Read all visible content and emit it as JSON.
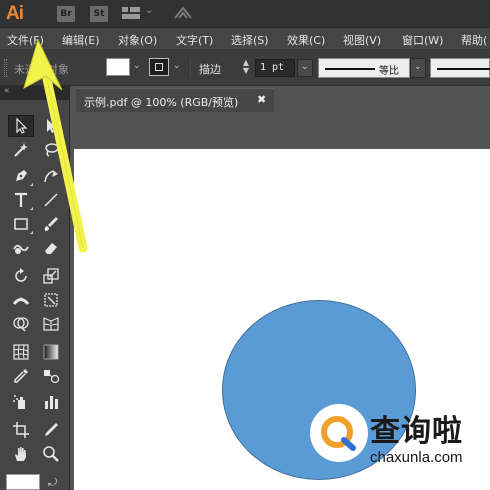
{
  "app": {
    "logo": "Ai",
    "bridge_badge": "Br",
    "stock_badge": "St",
    "accent_color": "#e8883a"
  },
  "menu": {
    "items": [
      "文件(F)",
      "编辑(E)",
      "对象(O)",
      "文字(T)",
      "选择(S)",
      "效果(C)",
      "视图(V)",
      "窗口(W)",
      "帮助("
    ]
  },
  "control": {
    "no_selection": "未选择对象",
    "stroke_label": "描边",
    "stroke_value": "1 pt",
    "profile_label": "等比"
  },
  "document": {
    "tab_label": "示例.pdf @ 100% (RGB/预览)",
    "close_symbol": "✖",
    "circle_fill": "#5b9bd5"
  },
  "watermark": {
    "brand": "查询啦",
    "url": "chaxunla.com"
  },
  "tools": [
    "selection-tool",
    "direct-selection-tool",
    "magic-wand-tool",
    "lasso-tool",
    "pen-tool",
    "curvature-tool",
    "type-tool",
    "line-tool",
    "rectangle-tool",
    "paintbrush-tool",
    "shaper-tool",
    "eraser-tool",
    "rotate-tool",
    "scale-tool",
    "width-tool",
    "free-transform-tool",
    "shape-builder-tool",
    "perspective-grid-tool",
    "mesh-tool",
    "gradient-tool",
    "eyedropper-tool",
    "blend-tool",
    "symbol-sprayer-tool",
    "column-graph-tool",
    "artboard-tool",
    "slice-tool",
    "hand-tool",
    "zoom-tool"
  ]
}
